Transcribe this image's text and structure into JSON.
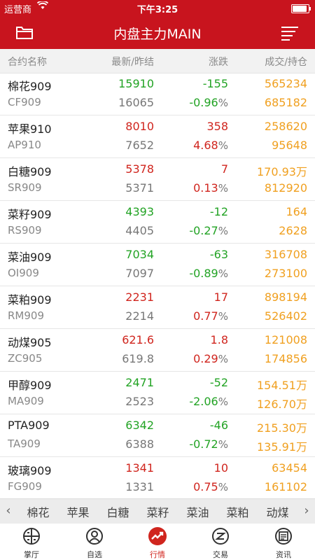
{
  "status_bar": {
    "carrier": "运营商",
    "time": "下午3:25",
    "battery_level": 0.9
  },
  "nav": {
    "title": "内盘主力MAIN",
    "left_icon": "folder-icon",
    "right_icon": "menu-icon"
  },
  "columns": {
    "name": "合约名称",
    "price": "最新/昨结",
    "change": "涨跌",
    "volume": "成交/持仓"
  },
  "colors": {
    "brand": "#c8141e",
    "up": "#d0251e",
    "down": "#22a324",
    "volume": "#f0a020"
  },
  "rows": [
    {
      "name": "棉花909",
      "code": "CF909",
      "last": "15910",
      "prev": "16065",
      "change": "-155",
      "pct": "-0.96",
      "volume": "565234",
      "oi": "685182",
      "dir": "down"
    },
    {
      "name": "苹果910",
      "code": "AP910",
      "last": "8010",
      "prev": "7652",
      "change": "358",
      "pct": "4.68",
      "volume": "258620",
      "oi": "95648",
      "dir": "up"
    },
    {
      "name": "白糖909",
      "code": "SR909",
      "last": "5378",
      "prev": "5371",
      "change": "7",
      "pct": "0.13",
      "volume": "170.93万",
      "oi": "812920",
      "dir": "up"
    },
    {
      "name": "菜籽909",
      "code": "RS909",
      "last": "4393",
      "prev": "4405",
      "change": "-12",
      "pct": "-0.27",
      "volume": "164",
      "oi": "2628",
      "dir": "down"
    },
    {
      "name": "菜油909",
      "code": "OI909",
      "last": "7034",
      "prev": "7097",
      "change": "-63",
      "pct": "-0.89",
      "volume": "316708",
      "oi": "273100",
      "dir": "down"
    },
    {
      "name": "菜粕909",
      "code": "RM909",
      "last": "2231",
      "prev": "2214",
      "change": "17",
      "pct": "0.77",
      "volume": "898194",
      "oi": "526402",
      "dir": "up"
    },
    {
      "name": "动煤905",
      "code": "ZC905",
      "last": "621.6",
      "prev": "619.8",
      "change": "1.8",
      "pct": "0.29",
      "volume": "121008",
      "oi": "174856",
      "dir": "up"
    },
    {
      "name": "甲醇909",
      "code": "MA909",
      "last": "2471",
      "prev": "2523",
      "change": "-52",
      "pct": "-2.06",
      "volume": "154.51万",
      "oi": "126.70万",
      "dir": "down"
    },
    {
      "name": "PTA909",
      "code": "TA909",
      "last": "6342",
      "prev": "6388",
      "change": "-46",
      "pct": "-0.72",
      "volume": "215.30万",
      "oi": "135.91万",
      "dir": "down"
    },
    {
      "name": "玻璃909",
      "code": "FG909",
      "last": "1341",
      "prev": "1331",
      "change": "10",
      "pct": "0.75",
      "volume": "63454",
      "oi": "161102",
      "dir": "up"
    }
  ],
  "pct_unit": "%",
  "shortcuts": {
    "prev_icon": "chevron-left-icon",
    "next_icon": "chevron-right-icon",
    "items": [
      "棉花",
      "苹果",
      "白糖",
      "菜籽",
      "菜油",
      "菜粕",
      "动煤"
    ]
  },
  "tabs": [
    {
      "label": "掌厅",
      "icon": "hall-icon",
      "active": false
    },
    {
      "label": "自选",
      "icon": "user-icon",
      "active": false
    },
    {
      "label": "行情",
      "icon": "trend-icon",
      "active": true
    },
    {
      "label": "交易",
      "icon": "trade-icon",
      "active": false
    },
    {
      "label": "资讯",
      "icon": "news-icon",
      "active": false
    }
  ]
}
